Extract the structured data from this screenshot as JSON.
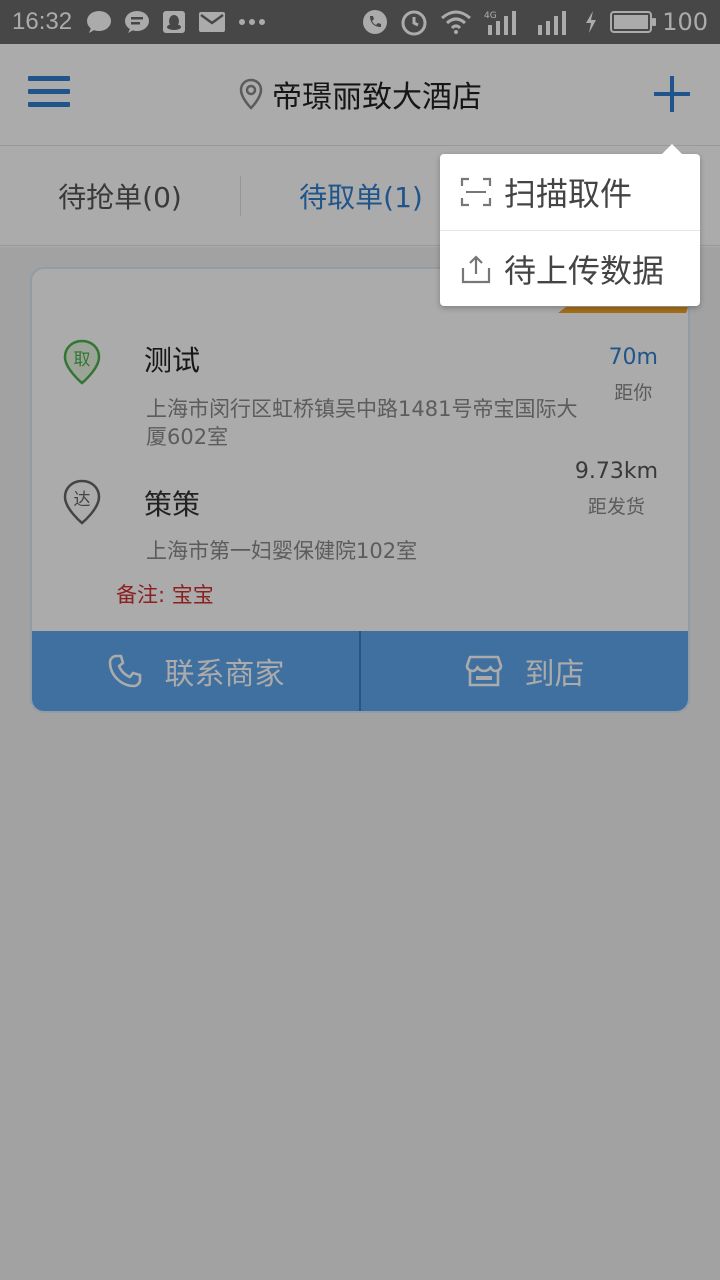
{
  "status_bar": {
    "time": "16:32",
    "network": "4G",
    "battery": "100",
    "battery_level": 1.0
  },
  "header": {
    "title": "帝璟丽致大酒店"
  },
  "tabs": [
    {
      "label": "待抢单(0)",
      "active": false
    },
    {
      "label": "待取单(1)",
      "active": true
    }
  ],
  "order": {
    "pickup": {
      "badge": "取",
      "name": "测试",
      "address": "上海市闵行区虹桥镇吴中路1481号帝宝国际大厦602室",
      "distance": "70m",
      "distance_label": "距你"
    },
    "delivery": {
      "badge": "达",
      "name": "策策",
      "address": "上海市第一妇婴保健院102室",
      "distance": "9.73km",
      "distance_label": "距发货"
    },
    "note": "备注: 宝宝",
    "actions": {
      "contact": "联系商家",
      "arrive": "到店"
    }
  },
  "popup_menu": {
    "items": [
      {
        "label": "扫描取件",
        "icon": "scan-icon"
      },
      {
        "label": "待上传数据",
        "icon": "upload-icon"
      }
    ]
  },
  "colors": {
    "accent": "#2f7fd0",
    "pickup_green": "#4caf50",
    "note_red": "#d03030",
    "ribbon": "#f5a623"
  }
}
